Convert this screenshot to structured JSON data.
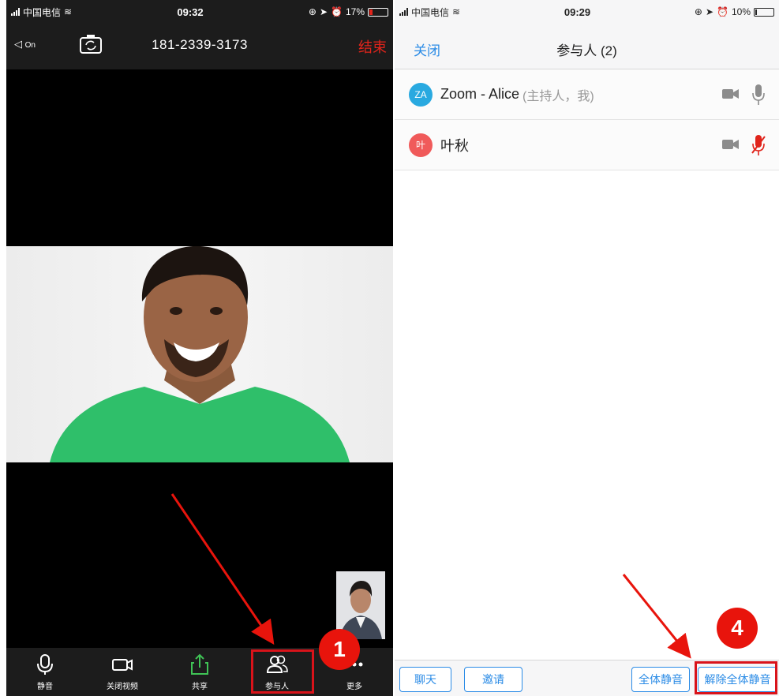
{
  "left_phone": {
    "status": {
      "carrier": "中国电信",
      "time": "09:32",
      "battery": "17%"
    },
    "topbar": {
      "speaker_label": "On",
      "meeting_number": "181-2339-3173",
      "end_label": "结束"
    },
    "toolbar": [
      {
        "icon": "mic-icon",
        "label": "静音"
      },
      {
        "icon": "video-camera-icon",
        "label": "关闭视频"
      },
      {
        "icon": "share-icon",
        "label": "共享"
      },
      {
        "icon": "participants-icon",
        "label": "参与人"
      },
      {
        "icon": "more-icon",
        "label": "更多"
      }
    ]
  },
  "right_phone": {
    "status": {
      "carrier": "中国电信",
      "time": "09:29",
      "battery": "10%"
    },
    "nav": {
      "close_label": "关闭",
      "title": "参与人 (2)"
    },
    "participants": [
      {
        "initials": "ZA",
        "name": "Zoom - Alice",
        "role": "(主持人，我)",
        "avatar_color": "#29a9e0",
        "muted": false
      },
      {
        "initials": "叶",
        "name": "叶秋",
        "role": "",
        "avatar_color": "#f05a5a",
        "muted": true
      }
    ],
    "bottom_buttons": {
      "chat": "聊天",
      "invite": "邀请",
      "mute_all": "全体静音",
      "unmute_all": "解除全体静音"
    }
  },
  "annotations": {
    "step_1": "1",
    "step_4": "4"
  },
  "colors": {
    "accent_blue": "#2a8be6",
    "end_red": "#e0241b",
    "annotation_red": "#e8140c",
    "muted_red": "#e0241b"
  }
}
